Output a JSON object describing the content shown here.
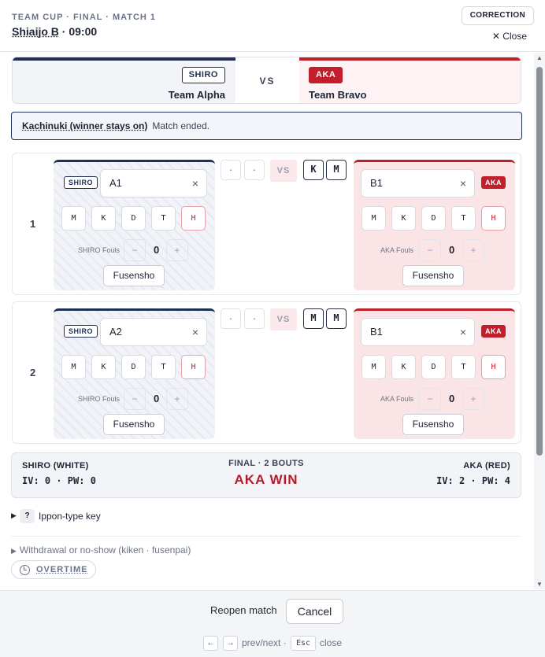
{
  "header": {
    "eyebrow": "TEAM CUP · FINAL · MATCH 1",
    "court": "Shiaijo B",
    "time": " · 09:00",
    "correction_label": "CORRECTION",
    "close_label": "✕ Close"
  },
  "teams": {
    "vs": "VS",
    "shiro": {
      "tag": "SHIRO",
      "name": "Team Alpha"
    },
    "aka": {
      "tag": "AKA",
      "name": "Team Bravo"
    }
  },
  "format": {
    "name": "Kachinuki (winner stays on)",
    "status": "Match ended."
  },
  "ippon_types": [
    "M",
    "K",
    "D",
    "T",
    "H"
  ],
  "bouts": [
    {
      "number": "1",
      "shiro": {
        "tag": "SHIRO",
        "player": "A1",
        "fouls_label": "SHIRO Fouls",
        "fouls": "0",
        "fusensho": "Fusensho"
      },
      "aka": {
        "tag": "AKA",
        "player": "B1",
        "fouls_label": "AKA Fouls",
        "fouls": "0",
        "fusensho": "Fusensho"
      },
      "shiro_marks": [
        "·",
        "·"
      ],
      "vs": "VS",
      "aka_marks": [
        "K",
        "M"
      ]
    },
    {
      "number": "2",
      "shiro": {
        "tag": "SHIRO",
        "player": "A2",
        "fouls_label": "SHIRO Fouls",
        "fouls": "0",
        "fusensho": "Fusensho"
      },
      "aka": {
        "tag": "AKA",
        "player": "B1",
        "fouls_label": "AKA Fouls",
        "fouls": "0",
        "fusensho": "Fusensho"
      },
      "shiro_marks": [
        "·",
        "·"
      ],
      "vs": "VS",
      "aka_marks": [
        "M",
        "M"
      ]
    }
  ],
  "controls": {
    "clear": "×",
    "minus": "−",
    "plus": "+"
  },
  "summary": {
    "shiro_label": "SHIRO (WHITE)",
    "shiro_score": "IV: 0 · PW: 0",
    "final_label": "FINAL · 2 BOUTS",
    "result": "AKA WIN",
    "aka_label": "AKA (RED)",
    "aka_score": "IV: 2 · PW: 4"
  },
  "ippon_key": {
    "arrow": "▶",
    "q": "?",
    "label": "Ippon-type key"
  },
  "withdrawal": {
    "arrow": "▶",
    "label": "Withdrawal or no-show (kiken · fusenpai)"
  },
  "overtime_label": "OVERTIME",
  "footer": {
    "reopen": "Reopen match",
    "cancel": "Cancel",
    "key_prev": "←",
    "key_next": "→",
    "prevnext": "prev/next ·",
    "key_esc": "Esc",
    "close": "close"
  },
  "colors": {
    "shiro": "#1f2f55",
    "aka": "#c11f2c",
    "result": "#b51c2a"
  }
}
